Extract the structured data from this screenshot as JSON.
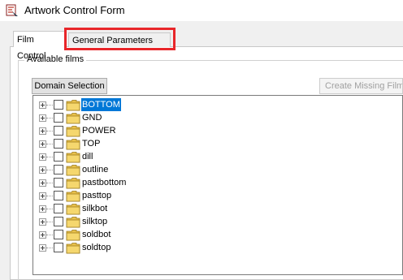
{
  "window": {
    "title": "Artwork Control Form"
  },
  "tabs": [
    {
      "label": "Film Control"
    },
    {
      "label": "General Parameters"
    }
  ],
  "film_control": {
    "group_label": "Available films",
    "domain_button": "Domain Selection",
    "create_button": "Create Missing Films"
  },
  "films": [
    {
      "label": "BOTTOM",
      "selected": true
    },
    {
      "label": "GND"
    },
    {
      "label": "POWER"
    },
    {
      "label": "TOP"
    },
    {
      "label": "dill"
    },
    {
      "label": "outline"
    },
    {
      "label": "pastbottom"
    },
    {
      "label": "pasttop"
    },
    {
      "label": "silkbot"
    },
    {
      "label": "silktop"
    },
    {
      "label": "soldbot"
    },
    {
      "label": "soldtop"
    }
  ],
  "colors": {
    "highlight_box": "#e8262a",
    "selection": "#0078d7",
    "folder": "#f5d76e"
  },
  "icons": {
    "app": "artwork-app-icon",
    "expander": "plus-box-icon",
    "folder": "folder-icon"
  }
}
